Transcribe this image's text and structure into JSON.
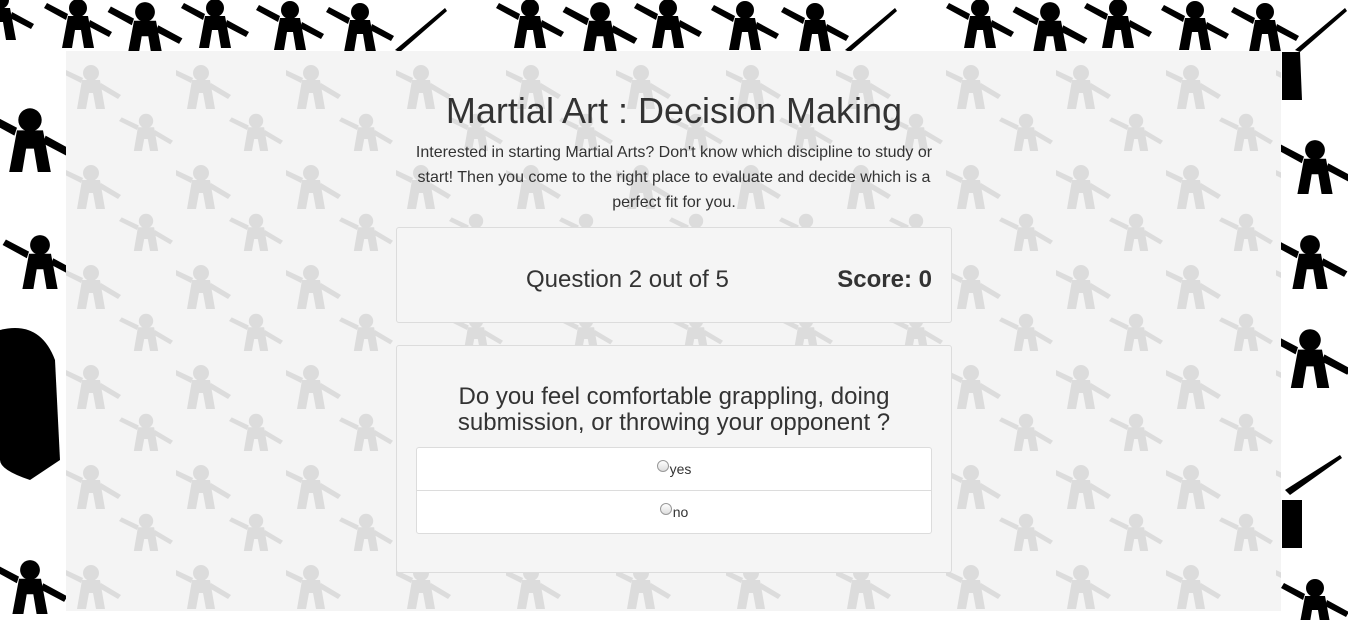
{
  "page": {
    "title": "Martial Art : Decision Making",
    "description": "Interested in starting Martial Arts? Don't know which discipline to study or start! Then you come to the right place to evaluate and decide which is a perfect fit for you."
  },
  "status": {
    "question_counter": "Question 2 out of 5",
    "score": "Score: 0"
  },
  "question": {
    "text": "Do you feel comfortable grappling, doing submission, or throwing your opponent ?",
    "options": [
      {
        "label": "yes",
        "selected": false
      },
      {
        "label": "no",
        "selected": false
      }
    ]
  },
  "colors": {
    "page_background": "#f4f4f4",
    "silhouette_outer": "#000000",
    "silhouette_inner": "#dcdcdc",
    "panel_background": "#f5f5f5",
    "panel_border": "#dcdcdc"
  },
  "icons": [
    "martial-artist-silhouette-icon",
    "radio-button-icon"
  ]
}
